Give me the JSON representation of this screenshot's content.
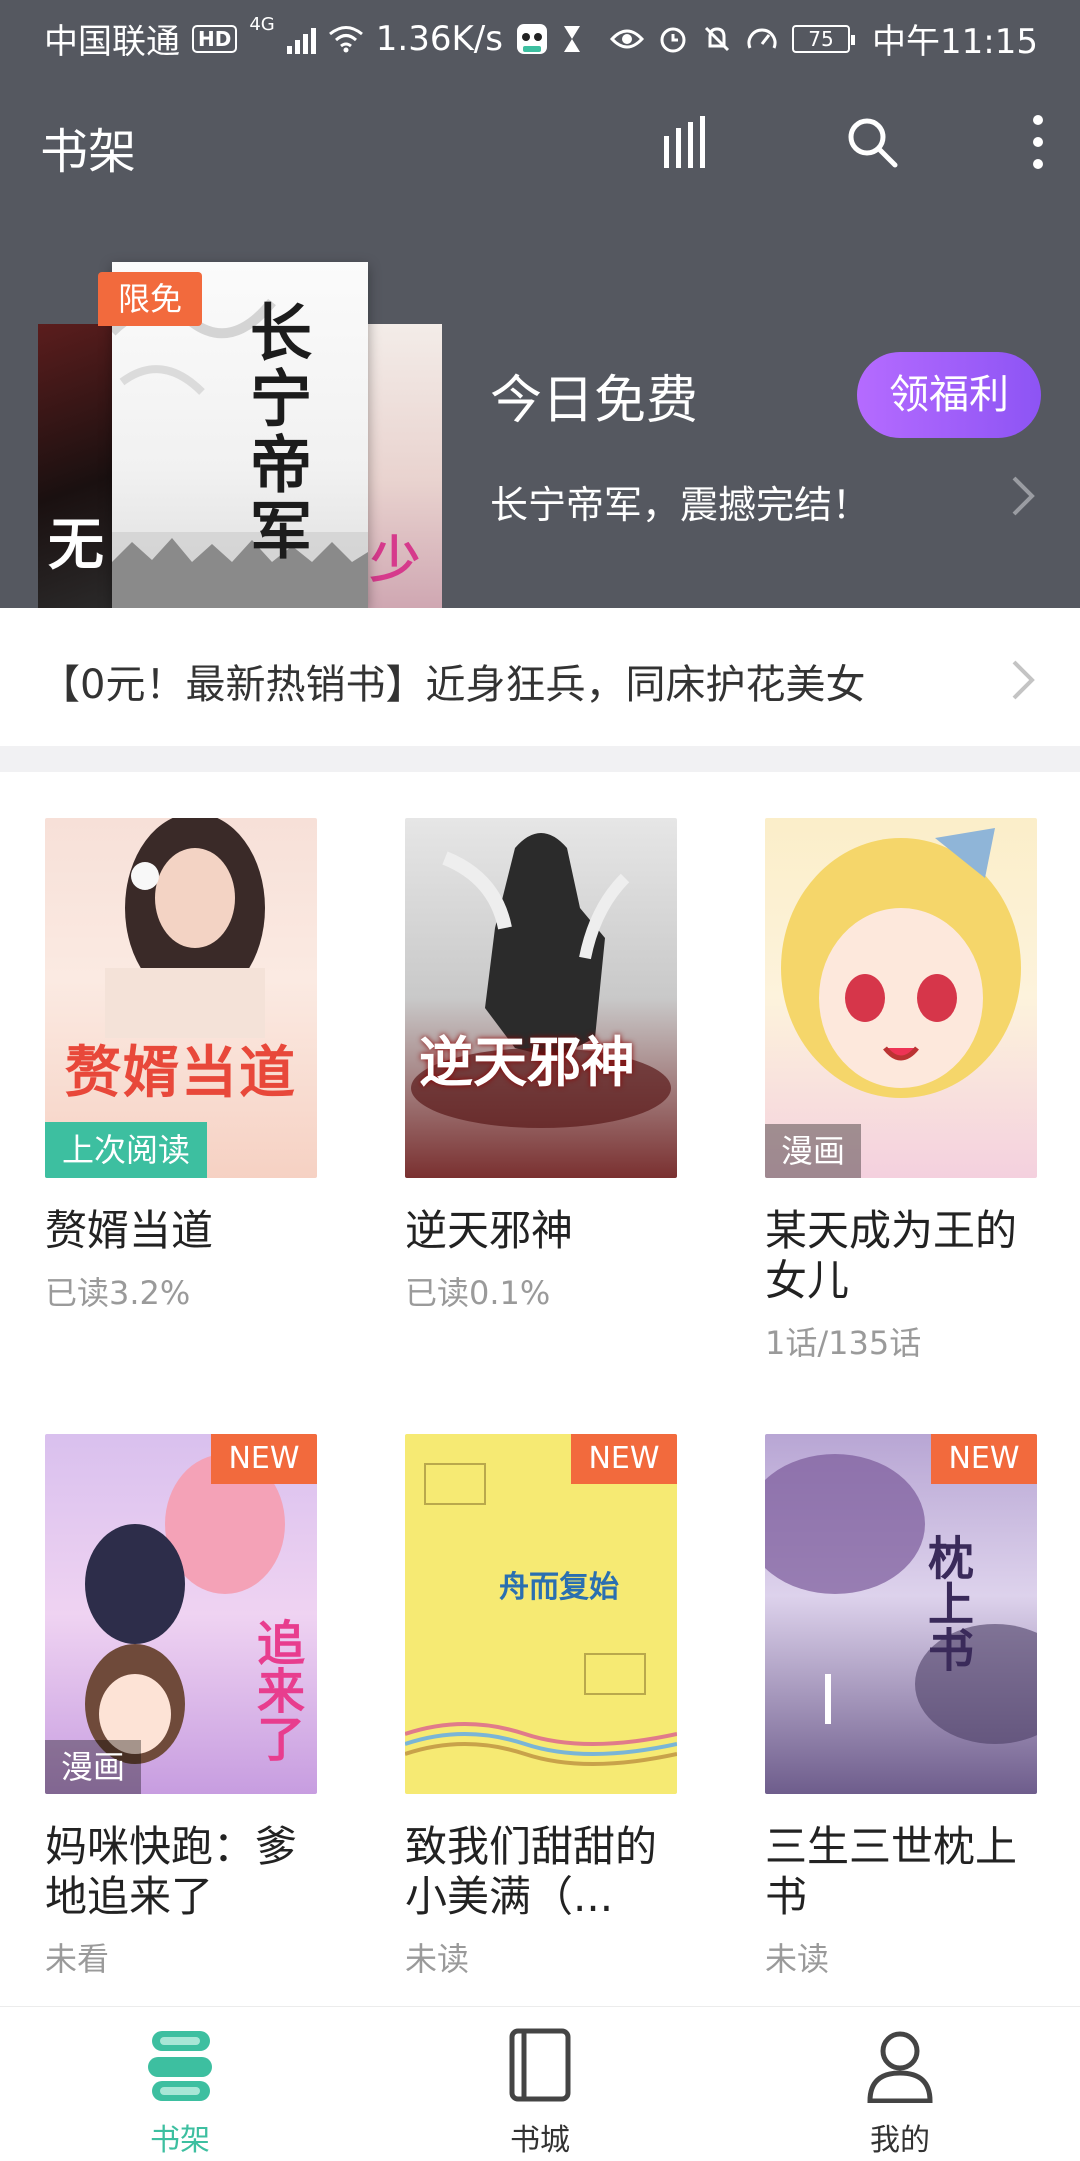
{
  "status_bar": {
    "carrier": "中国联通",
    "hd": "HD",
    "network": "4G",
    "speed": "1.36K/s",
    "battery": "75",
    "time": "中午11:15"
  },
  "toolbar": {
    "title": "书架",
    "icons": [
      "ranking-icon",
      "search-icon",
      "more-vertical-icon"
    ]
  },
  "promo": {
    "badge": "限免",
    "main_cover_title": "长宁帝军",
    "left_cover_text": "无",
    "right_cover_text": "少",
    "title": "今日免费",
    "button": "领福利",
    "subtitle": "长宁帝军，震撼完结！"
  },
  "notice": {
    "text": "【0元！最新热销书】近身狂兵，同床护花美女"
  },
  "books": [
    {
      "title": "赘婿当道",
      "progress": "已读3.2%",
      "badge": "上次阅读",
      "cover_text": "赘婿当道",
      "cover_colors": [
        "#fbe3da",
        "#f5c1b0"
      ]
    },
    {
      "title": "逆天邪神",
      "progress": "已读0.1%",
      "badge": "",
      "cover_text": "逆天邪神",
      "cover_colors": [
        "#d9d9d9",
        "#8a2a2a"
      ]
    },
    {
      "title": "某天成为王的女儿",
      "progress": "1话/135话",
      "badge": "漫画",
      "cover_text": "",
      "cover_colors": [
        "#fdf0c9",
        "#f5c8d6"
      ]
    },
    {
      "title": "妈咪快跑：爹地追来了",
      "progress": "未看",
      "badge": "漫画",
      "badge2": "NEW",
      "cover_text": "追来了",
      "cover_colors": [
        "#e8c8ef",
        "#c99ce0"
      ]
    },
    {
      "title": "致我们甜甜的小美满（...",
      "progress": "未读",
      "badge": "",
      "badge2": "NEW",
      "cover_text": "舟而复始",
      "cover_colors": [
        "#f7ec78",
        "#f2e06a"
      ]
    },
    {
      "title": "三生三世枕上书",
      "progress": "未读",
      "badge": "",
      "badge2": "NEW",
      "cover_text": "枕上书",
      "cover_colors": [
        "#cdbfe0",
        "#8a7aa8"
      ]
    }
  ],
  "tabs": [
    {
      "label": "书架",
      "icon": "bookshelf-icon",
      "active": true
    },
    {
      "label": "书城",
      "icon": "book-icon",
      "active": false
    },
    {
      "label": "我的",
      "icon": "profile-icon",
      "active": false
    }
  ],
  "colors": {
    "header": "#555860",
    "accent": "#3dbfa0",
    "badge_orange": "#f26a3d",
    "button_purple": "#9b5cf6"
  }
}
